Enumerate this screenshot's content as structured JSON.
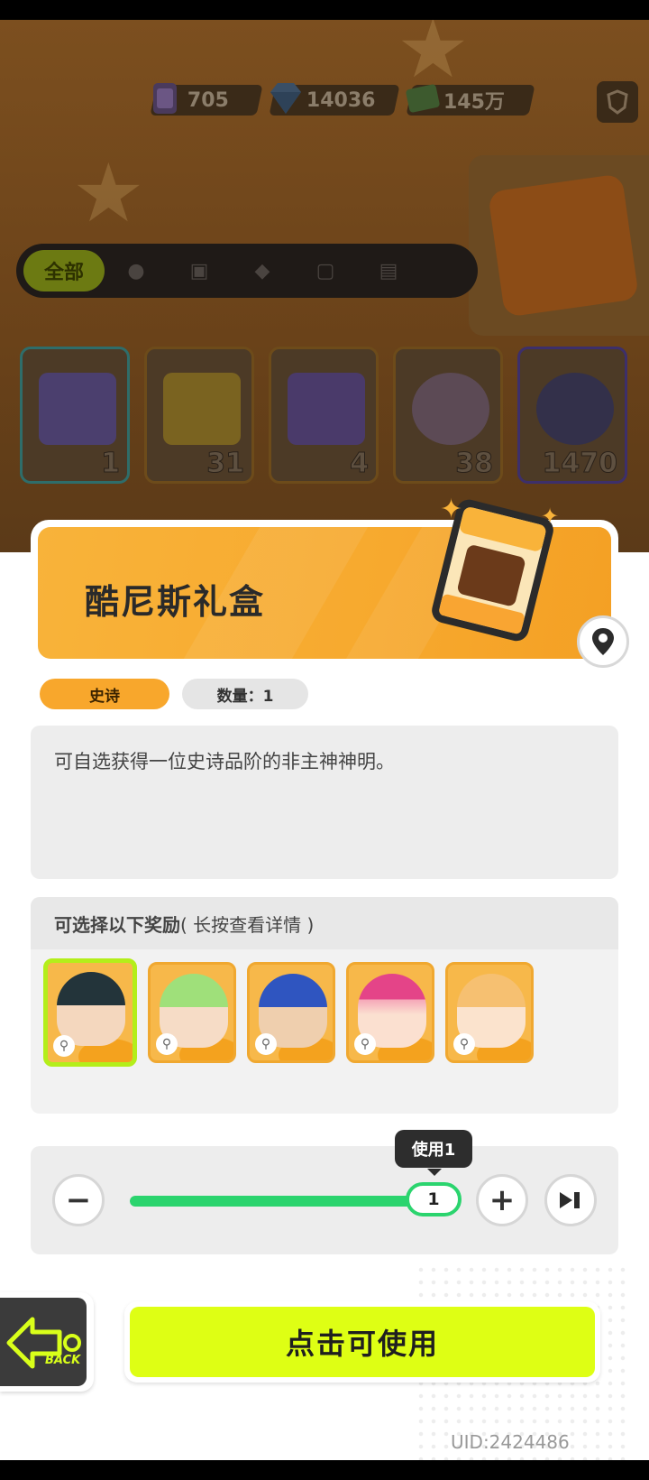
{
  "currencies": {
    "tickets": "705",
    "gems": "14036",
    "cash": "145万"
  },
  "tabs": [
    "全部"
  ],
  "inventory": [
    {
      "count": "1"
    },
    {
      "count": "31"
    },
    {
      "count": "4"
    },
    {
      "count": "38"
    },
    {
      "count": "1470"
    }
  ],
  "item": {
    "name": "酷尼斯礼盒",
    "rarity": "史诗",
    "quantity_label": "数量：1",
    "description": "可自选获得一位史诗品阶的非主神神明。"
  },
  "rewards": {
    "header": "可选择以下奖励",
    "hint": "( 长按查看详情 )"
  },
  "slider": {
    "value": "1",
    "tooltip": "使用1",
    "fill_fraction": 1.0
  },
  "buttons": {
    "back_label": "BACK",
    "use_label": "点击可使用",
    "minus": "−",
    "plus": "+"
  },
  "footer": {
    "uid": "UID:2424486"
  },
  "colors": {
    "accent_lime": "#deff14",
    "rarity_orange": "#f8a72c",
    "slider_green": "#2bd46e"
  }
}
